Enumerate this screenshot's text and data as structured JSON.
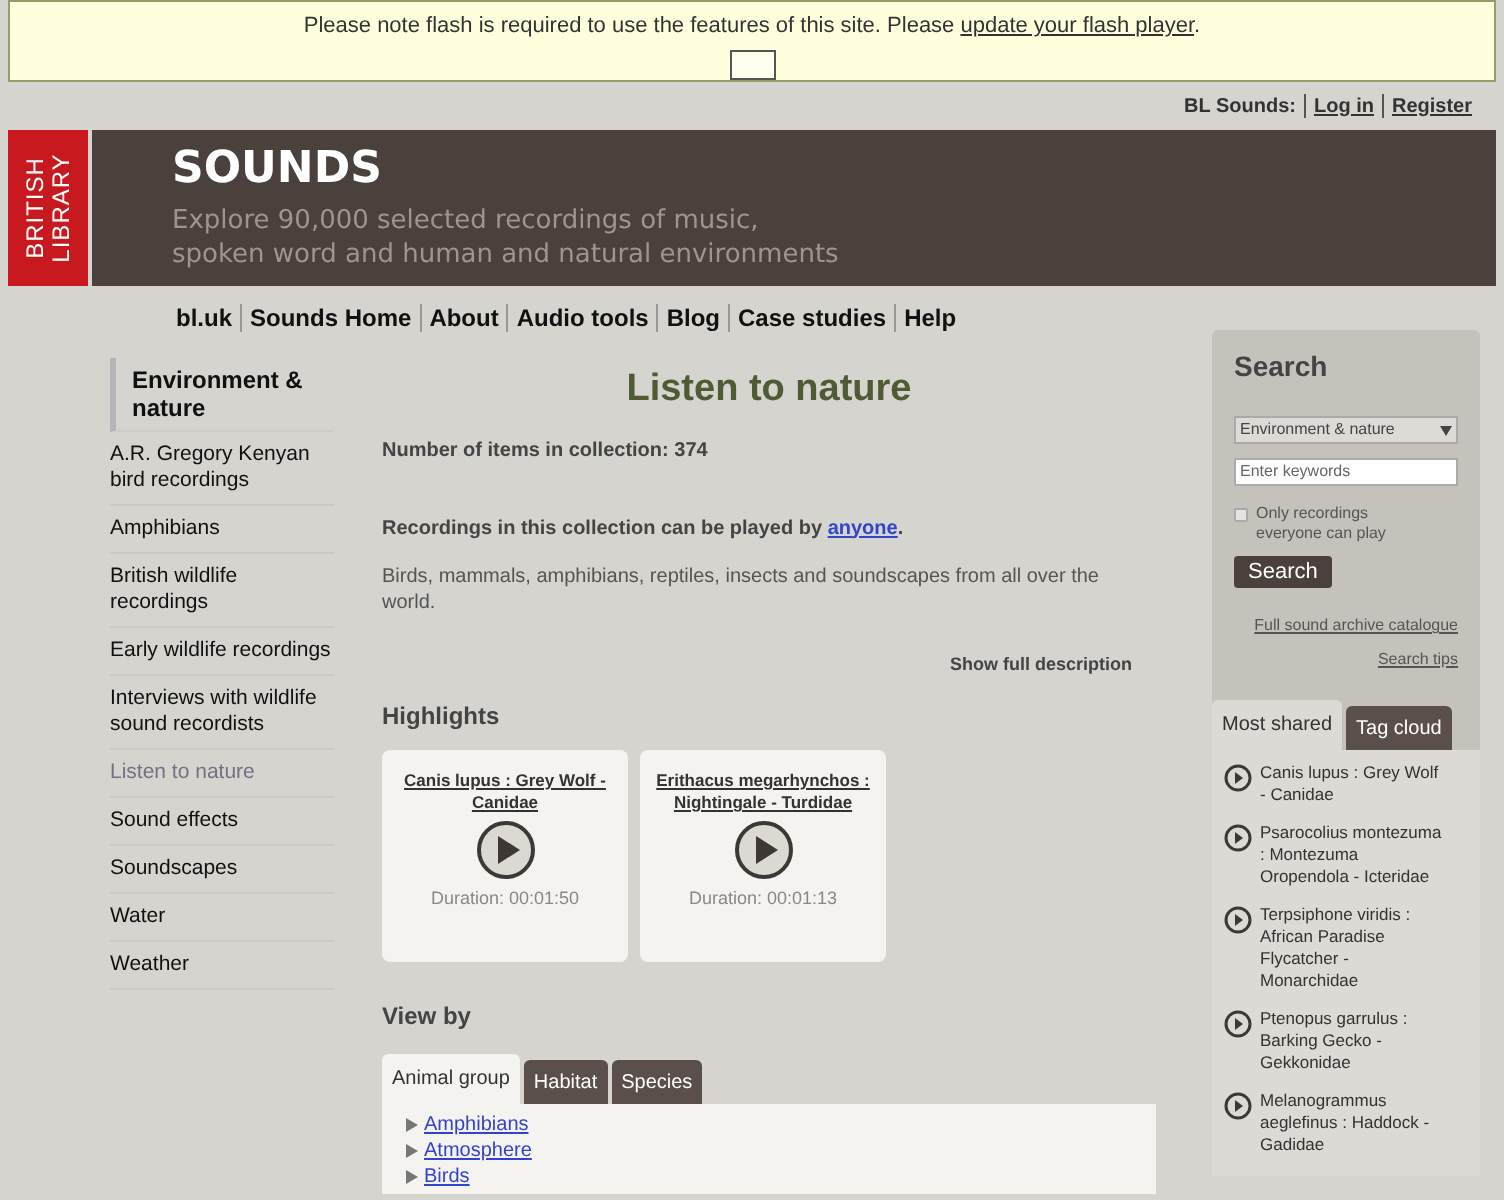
{
  "notice": {
    "text": "Please note flash is required to use the features of this site. Please ",
    "link": "update your flash player",
    "after": "."
  },
  "account": {
    "label": "BL Sounds:",
    "links": [
      "Log in",
      "Register"
    ]
  },
  "header": {
    "logo_lines": [
      "BRITISH",
      "LIBRARY"
    ],
    "title": "SOUNDS",
    "tagline_lines": [
      "Explore 90,000 selected recordings of music,",
      "spoken word and human and natural environments"
    ]
  },
  "nav": [
    "bl.uk",
    "Sounds Home",
    "About",
    "Audio tools",
    "Blog",
    "Case studies",
    "Help"
  ],
  "sidebar": {
    "heading": "Environment & nature",
    "items": [
      {
        "label": "A.R. Gregory Kenyan bird recordings",
        "selected": false
      },
      {
        "label": "Amphibians",
        "selected": false
      },
      {
        "label": "British wildlife recordings",
        "selected": false
      },
      {
        "label": "Early wildlife recordings",
        "selected": false
      },
      {
        "label": "Interviews with wildlife sound recordists",
        "selected": false
      },
      {
        "label": "Listen to nature",
        "selected": true
      },
      {
        "label": "Sound effects",
        "selected": false
      },
      {
        "label": "Soundscapes",
        "selected": false
      },
      {
        "label": "Water",
        "selected": false
      },
      {
        "label": "Weather",
        "selected": false
      }
    ]
  },
  "main": {
    "title": "Listen to nature",
    "count": "Number of items in collection: 374",
    "access": {
      "text": "Recordings in this collection can be played by ",
      "link": "anyone",
      "after": "."
    },
    "description": "Birds, mammals, amphibians, reptiles, insects and soundscapes from all over the world.",
    "show_full": "Show full description",
    "highlights_heading": "Highlights",
    "highlights": [
      {
        "title": "Canis lupus : Grey Wolf - Canidae",
        "duration": "Duration: 00:01:50"
      },
      {
        "title": "Erithacus megarhynchos : Nightingale - Turdidae",
        "duration": "Duration: 00:01:13"
      }
    ],
    "view_by_heading": "View by",
    "tabs": [
      {
        "label": "Animal group",
        "selected": true
      },
      {
        "label": "Habitat",
        "selected": false
      },
      {
        "label": "Species",
        "selected": false
      }
    ],
    "groups": [
      "Amphibians",
      "Atmosphere",
      "Birds"
    ]
  },
  "search": {
    "heading": "Search",
    "select_value": "Environment & nature",
    "placeholder": "Enter keywords",
    "checkbox": {
      "label": "Only recordings everyone can play",
      "checked": false
    },
    "button": "Search",
    "catalogue_link": "Full sound archive catalogue",
    "tips_link": "Search tips",
    "tabs": [
      {
        "label": "Most shared",
        "selected": true
      },
      {
        "label": "Tag cloud",
        "selected": false
      }
    ],
    "shared": [
      "Canis lupus : Grey Wolf - Canidae",
      "Psarocolius montezuma : Montezuma Oropendola - Icteridae",
      "Terpsiphone viridis : African Paradise Flycatcher - Monarchidae",
      "Ptenopus garrulus : Barking Gecko - Gekkonidae",
      "Melanogrammus aeglefinus : Haddock - Gadidae"
    ]
  }
}
